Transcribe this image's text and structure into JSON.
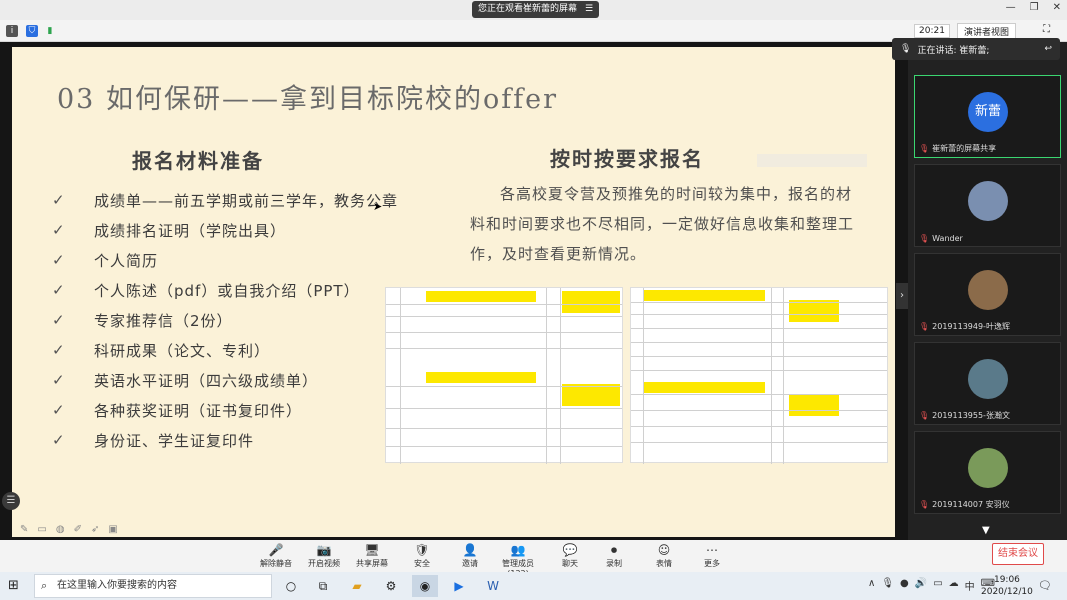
{
  "top": {
    "share_notice": "您正在观看崔新蕾的屏幕",
    "time_badge": "20:21",
    "view_label": "演讲者视图"
  },
  "slide": {
    "title": "03 如何保研——拿到目标院校的offer",
    "left_heading": "报名材料准备",
    "right_heading": "按时按要求报名",
    "items": [
      "成绩单——前五学期或前三学年，教务公章",
      "成绩排名证明（学院出具）",
      "个人简历",
      "个人陈述（pdf）或自我介绍（PPT）",
      "专家推荐信（2份）",
      "科研成果（论文、专利）",
      "英语水平证明（四六级成绩单）",
      "各种获奖证明（证书复印件）",
      "身份证、学生证复印件"
    ],
    "check": "✓",
    "paragraph": "各高校夏令营及预推免的时间较为集中，报名的材料和时间要求也不尽相同，一定做好信息收集和整理工作，及时查看更新情况。"
  },
  "speaking": {
    "label": "正在讲话: 崔新蕾;"
  },
  "participants": [
    {
      "name": "崔新蕾的屏幕共享",
      "avatar": "新蕾",
      "color": "#2b6fe0",
      "active": true
    },
    {
      "name": "Wander",
      "avatar": "",
      "color": "#7a8fb0",
      "active": false
    },
    {
      "name": "2019113949-叶逸辉",
      "avatar": "",
      "color": "#8b6b4a",
      "active": false
    },
    {
      "name": "2019113955-张瀚文",
      "avatar": "",
      "color": "#5a7a8a",
      "active": false
    },
    {
      "name": "2019114007 安羽仪",
      "avatar": "",
      "color": "#7a9a5a",
      "active": false
    }
  ],
  "bottom_buttons": [
    {
      "label": "解除静音",
      "icon": "🎤"
    },
    {
      "label": "开启视频",
      "icon": "📷"
    },
    {
      "label": "共享屏幕",
      "icon": "🖥"
    },
    {
      "label": "安全",
      "icon": "🛡"
    },
    {
      "label": "邀请",
      "icon": "👤"
    },
    {
      "label": "管理成员(122)",
      "icon": "👥"
    },
    {
      "label": "聊天",
      "icon": "💬"
    },
    {
      "label": "录制",
      "icon": "⏺"
    },
    {
      "label": "表情",
      "icon": "☺"
    },
    {
      "label": "更多",
      "icon": "⋯"
    }
  ],
  "end_meeting": "结束会议",
  "taskbar": {
    "search_placeholder": "在这里输入你要搜索的内容",
    "time": "19:06",
    "date": "2020/12/10",
    "ime": "中"
  }
}
